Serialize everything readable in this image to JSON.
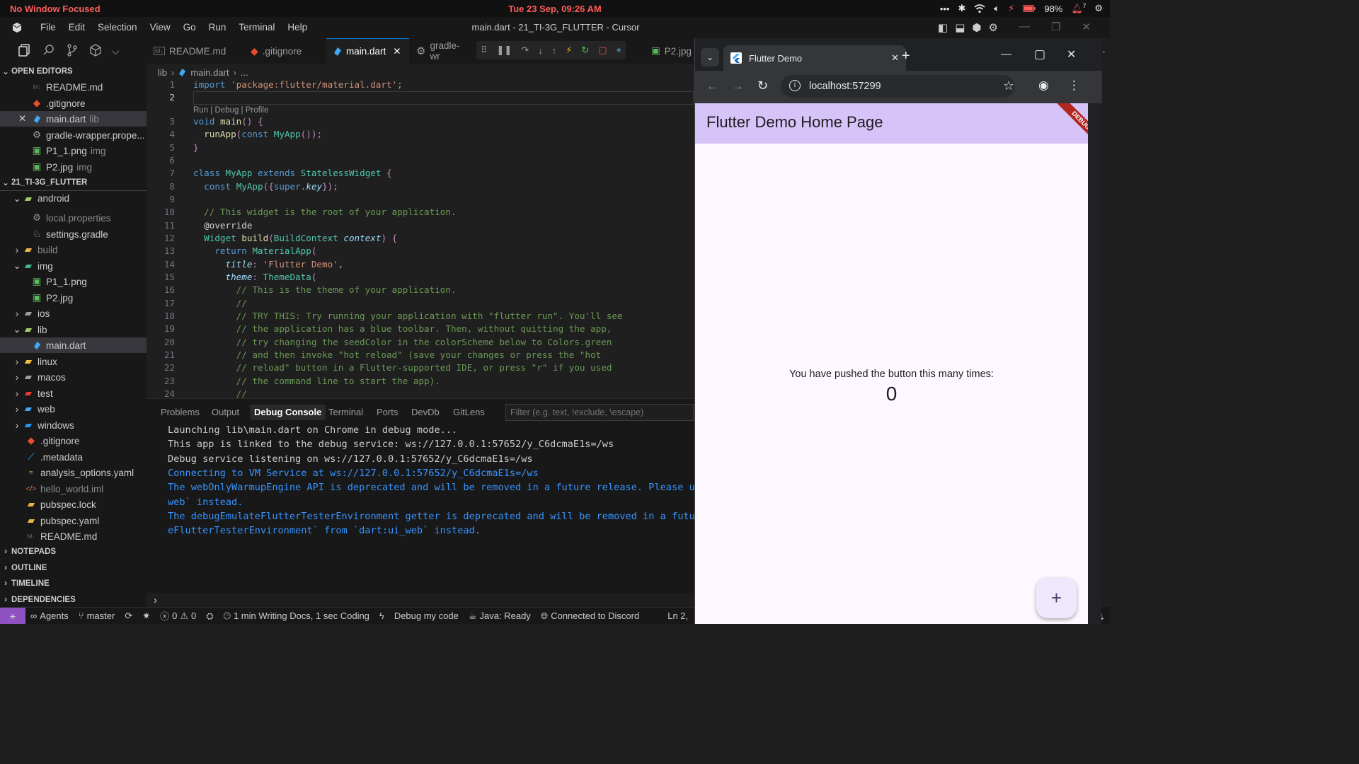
{
  "system": {
    "focus_status": "No Window Focused",
    "datetime": "Tue 23 Sep, 09:26 AM",
    "battery": "98%",
    "notification_count": "7"
  },
  "menu": {
    "items": [
      "File",
      "Edit",
      "Selection",
      "View",
      "Go",
      "Run",
      "Terminal",
      "Help"
    ],
    "window_title": "main.dart - 21_TI-3G_FLUTTER - Cursor"
  },
  "tabs": [
    {
      "label": "README.md"
    },
    {
      "label": ".gitignore"
    },
    {
      "label": "main.dart"
    },
    {
      "label": "gradle-wr"
    },
    {
      "label": "P2.jpg"
    }
  ],
  "sidebar": {
    "open_editors_title": "OPEN EDITORS",
    "open_editors": [
      {
        "label": "README.md",
        "suffix": ""
      },
      {
        "label": ".gitignore",
        "suffix": ""
      },
      {
        "label": "main.dart",
        "suffix": "lib"
      },
      {
        "label": "gradle-wrapper.prope...",
        "suffix": ""
      },
      {
        "label": "P1_1.png",
        "suffix": "img"
      },
      {
        "label": "P2.jpg",
        "suffix": "img"
      }
    ],
    "project_title": "21_TI-3G_FLUTTER",
    "tree": [
      {
        "label": "android"
      },
      {
        "label": "local.properties"
      },
      {
        "label": "settings.gradle"
      },
      {
        "label": "build"
      },
      {
        "label": "img"
      },
      {
        "label": "P1_1.png"
      },
      {
        "label": "P2.jpg"
      },
      {
        "label": "ios"
      },
      {
        "label": "lib"
      },
      {
        "label": "main.dart"
      },
      {
        "label": "linux"
      },
      {
        "label": "macos"
      },
      {
        "label": "test"
      },
      {
        "label": "web"
      },
      {
        "label": "windows"
      },
      {
        "label": ".gitignore"
      },
      {
        "label": ".metadata"
      },
      {
        "label": "analysis_options.yaml"
      },
      {
        "label": "hello_world.iml"
      },
      {
        "label": "pubspec.lock"
      },
      {
        "label": "pubspec.yaml"
      },
      {
        "label": "README.md"
      }
    ],
    "sections": [
      "NOTEPADS",
      "OUTLINE",
      "TIMELINE",
      "DEPENDENCIES"
    ]
  },
  "editor": {
    "breadcrumb": [
      "lib",
      "main.dart",
      "..."
    ],
    "codelens": "Run | Debug | Profile",
    "lines": [
      {
        "n": "1",
        "code": "import 'package:flutter/material.dart';"
      },
      {
        "n": "2",
        "code": ""
      },
      {
        "n": "3",
        "code": "void main() {"
      },
      {
        "n": "4",
        "code": "  runApp(const MyApp());"
      },
      {
        "n": "5",
        "code": "}"
      },
      {
        "n": "6",
        "code": ""
      },
      {
        "n": "7",
        "code": "class MyApp extends StatelessWidget {"
      },
      {
        "n": "8",
        "code": "  const MyApp({super.key});"
      },
      {
        "n": "9",
        "code": ""
      },
      {
        "n": "10",
        "code": "  // This widget is the root of your application."
      },
      {
        "n": "11",
        "code": "  @override"
      },
      {
        "n": "12",
        "code": "  Widget build(BuildContext context) {"
      },
      {
        "n": "13",
        "code": "    return MaterialApp("
      },
      {
        "n": "14",
        "code": "      title: 'Flutter Demo',"
      },
      {
        "n": "15",
        "code": "      theme: ThemeData("
      },
      {
        "n": "16",
        "code": "        // This is the theme of your application."
      },
      {
        "n": "17",
        "code": "        //"
      },
      {
        "n": "18",
        "code": "        // TRY THIS: Try running your application with \"flutter run\". You'll see"
      },
      {
        "n": "19",
        "code": "        // the application has a blue toolbar. Then, without quitting the app,"
      },
      {
        "n": "20",
        "code": "        // try changing the seedColor in the colorScheme below to Colors.green"
      },
      {
        "n": "21",
        "code": "        // and then invoke \"hot reload\" (save your changes or press the \"hot"
      },
      {
        "n": "22",
        "code": "        // reload\" button in a Flutter-supported IDE, or press \"r\" if you used"
      },
      {
        "n": "23",
        "code": "        // the command line to start the app)."
      },
      {
        "n": "24",
        "code": "        //"
      }
    ]
  },
  "panel": {
    "tabs": [
      "Problems",
      "Output",
      "Debug Console",
      "Terminal",
      "Ports",
      "DevDb",
      "GitLens"
    ],
    "filter_placeholder": "Filter (e.g. text, !exclude, \\escape)",
    "console": [
      {
        "text": "Launching lib\\main.dart on Chrome in debug mode...",
        "kind": "plain"
      },
      {
        "text": "This app is linked to the debug service: ws://127.0.0.1:57652/y_C6dcmaE1s=/ws",
        "kind": "plain"
      },
      {
        "text": "Debug service listening on ws://127.0.0.1:57652/y_C6dcmaE1s=/ws",
        "kind": "plain"
      },
      {
        "text": "Connecting to VM Service at ws://127.0.0.1:57652/y_C6dcmaE1s=/ws",
        "kind": "info"
      },
      {
        "text": "The webOnlyWarmupEngine API is deprecated and will be removed in a future release. Please use `",
        "kind": "info"
      },
      {
        "text": "web` instead.",
        "kind": "info"
      },
      {
        "text": "The debugEmulateFlutterTesterEnvironment getter is deprecated and will be removed in a future r",
        "kind": "info"
      },
      {
        "text": "eFlutterTesterEnvironment` from `dart:ui_web` instead.",
        "kind": "info"
      }
    ]
  },
  "statusbar": {
    "agents": "Agents",
    "branch": "master",
    "errors": "0",
    "warnings": "0",
    "time_tracking": "1 min Writing Docs, 1 sec Coding",
    "debug": "Debug my code",
    "java": "Java: Ready",
    "discord": "Connected to Discord",
    "position": "Ln 2,"
  },
  "browser": {
    "tab_title": "Flutter Demo",
    "url": "localhost:57299",
    "app_title": "Flutter Demo Home Page",
    "banner": "DEBUG",
    "counter_label": "You have pushed the button this many times:",
    "counter_value": "0",
    "fab_label": "+"
  },
  "colors": {
    "accent": "#0078d4",
    "app_bar": "#d6c3f8",
    "debug_banner": "#b3261e",
    "console_plain": "#cccccc",
    "console_info": "#3794ff",
    "focus_text": "#ff5c5c"
  }
}
